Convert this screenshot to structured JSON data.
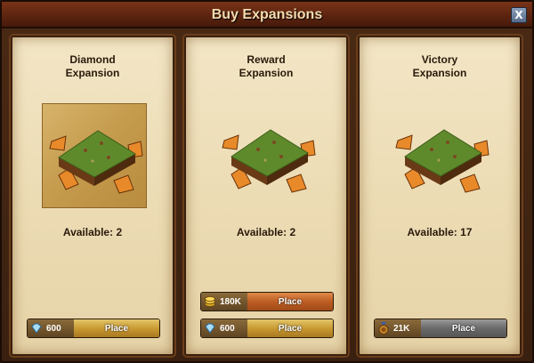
{
  "window": {
    "title": "Buy Expansions",
    "close_label": "X"
  },
  "panels": [
    {
      "title": "Diamond\nExpansion",
      "available": "Available: 2",
      "buttons": [
        {
          "cost": "600",
          "currency_icon": "diamond-icon",
          "label": "Place",
          "style": "gold"
        }
      ]
    },
    {
      "title": "Reward\nExpansion",
      "available": "Available: 2",
      "buttons": [
        {
          "cost": "180K",
          "currency_icon": "coins-icon",
          "label": "Place",
          "style": "orange"
        },
        {
          "cost": "600",
          "currency_icon": "diamond-icon",
          "label": "Place",
          "style": "gold"
        }
      ]
    },
    {
      "title": "Victory\nExpansion",
      "available": "Available: 17",
      "buttons": [
        {
          "cost": "21K",
          "currency_icon": "medal-icon",
          "label": "Place",
          "style": "grey"
        }
      ]
    }
  ],
  "colors": {
    "title_text": "#f3dcae",
    "parchment": "#ecdcb4",
    "frame": "#4a2a14"
  }
}
